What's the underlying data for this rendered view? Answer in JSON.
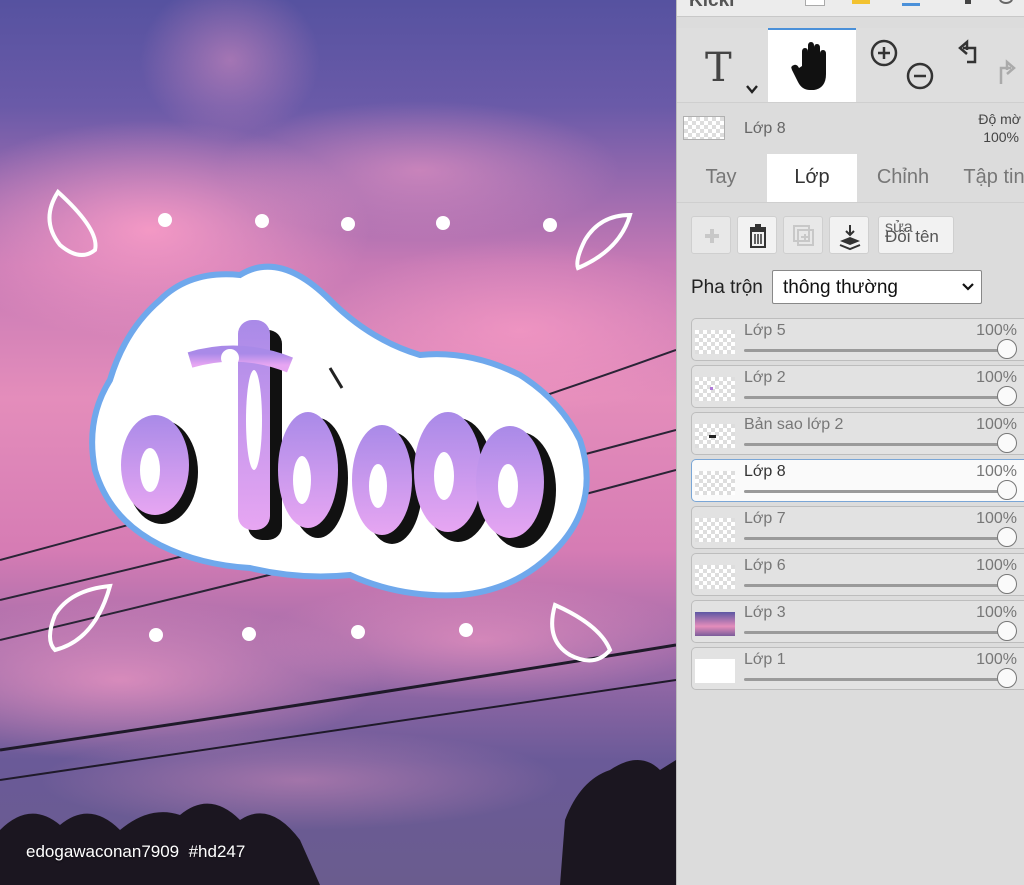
{
  "app": {
    "brand": "Kicki"
  },
  "canvas": {
    "watermark": "edogawaconan7909  #hd247",
    "artwork_alt": "sticker lettering on pink sunset sky"
  },
  "toolbar": {
    "tools": [
      {
        "name": "text-tool",
        "icon": "text-T-icon"
      },
      {
        "name": "hand-tool",
        "icon": "hand-icon",
        "selected": true
      },
      {
        "name": "zoom-tool",
        "icon": "zoom-in-zoom-out-icon"
      },
      {
        "name": "undo-redo",
        "icon": "undo-redo-icon"
      }
    ]
  },
  "current_layer": {
    "name": "Lớp 8",
    "opacity_label": "Độ mờ",
    "opacity": "100%"
  },
  "tabs": [
    {
      "label": "Tay"
    },
    {
      "label": "Lớp",
      "active": true
    },
    {
      "label": "Chỉnh"
    },
    {
      "label": "Tập tin"
    }
  ],
  "layer_actions": {
    "add_icon": "plus-icon",
    "delete_icon": "trash-icon",
    "duplicate_icon": "duplicate-icon",
    "merge_icon": "merge-down-icon",
    "rename_small": "sửa",
    "rename_label": "Đổi tên"
  },
  "blend": {
    "label": "Pha trộn",
    "value": "thông thường"
  },
  "layers": [
    {
      "name": "Lớp 5",
      "opacity": "100%",
      "opacity_value": 1.0
    },
    {
      "name": "Lớp 2",
      "opacity": "100%",
      "opacity_value": 1.0
    },
    {
      "name": "Bản sao lớp 2",
      "opacity": "100%",
      "opacity_value": 1.0
    },
    {
      "name": "Lớp 8",
      "opacity": "100%",
      "opacity_value": 1.0,
      "selected": true
    },
    {
      "name": "Lớp 7",
      "opacity": "100%",
      "opacity_value": 1.0
    },
    {
      "name": "Lớp 6",
      "opacity": "100%",
      "opacity_value": 1.0
    },
    {
      "name": "Lớp 3",
      "opacity": "100%",
      "opacity_value": 1.0
    },
    {
      "name": "Lớp 1",
      "opacity": "100%",
      "opacity_value": 1.0
    }
  ],
  "colors": {
    "accent": "#4a90d9",
    "sky_top": "#5d57a3",
    "sky_pink": "#e98bb8",
    "sticker_outline": "#6fa8ec",
    "letter_fill": "#c58df0"
  }
}
